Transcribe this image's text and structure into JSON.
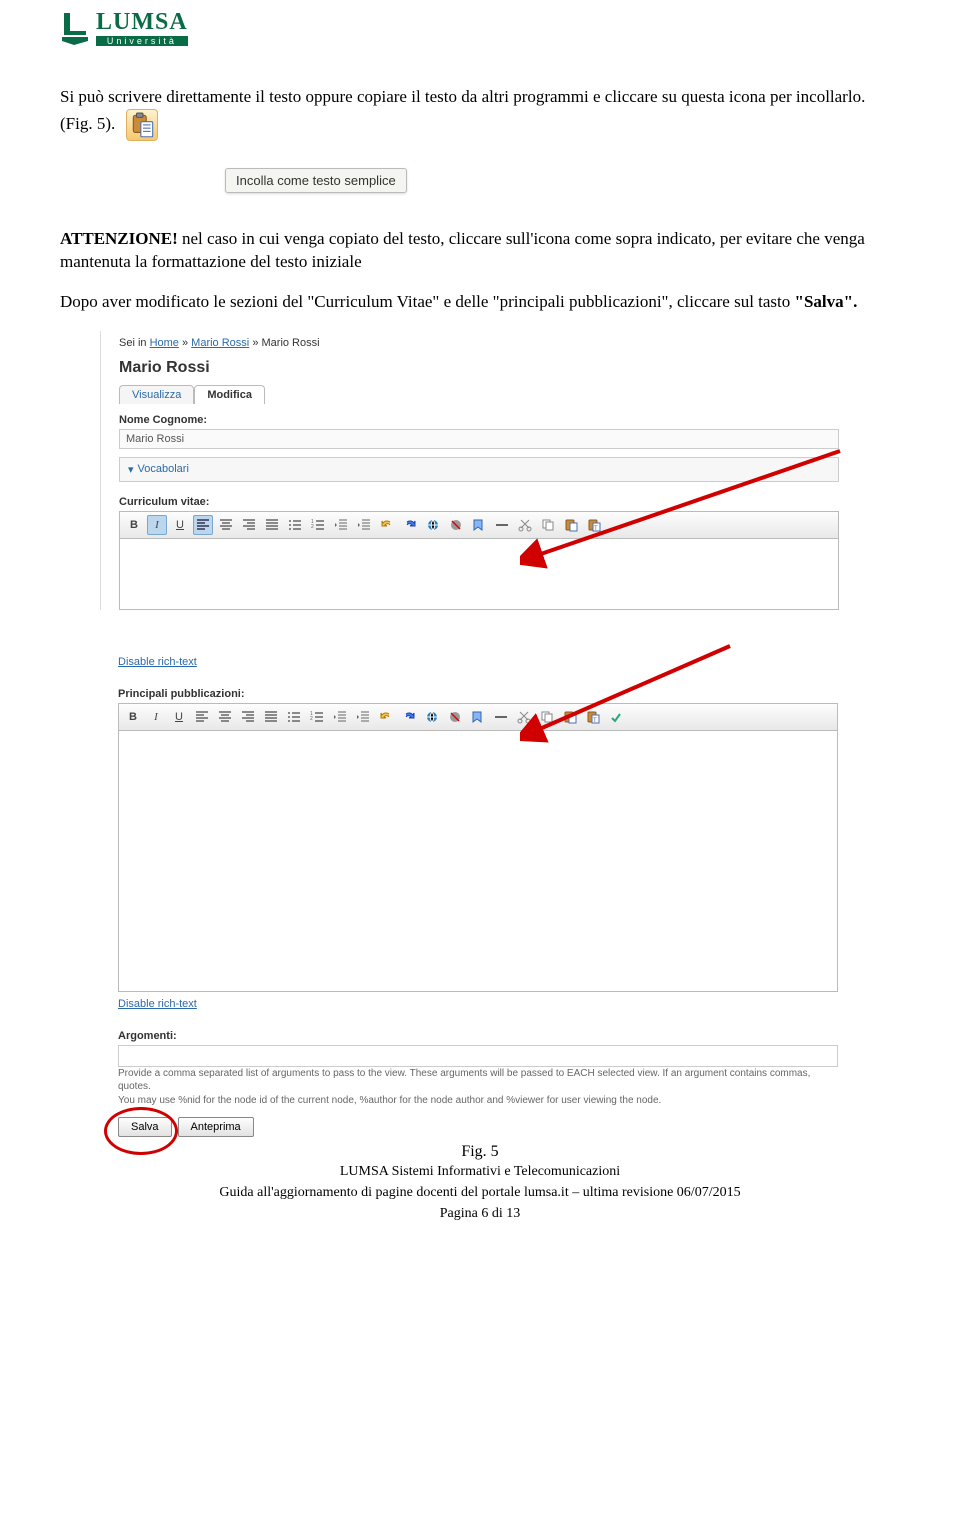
{
  "logo": {
    "name": "LUMSA",
    "sub": "Università"
  },
  "p1a": "Si può scrivere direttamente il testo oppure copiare il testo da altri programmi e cliccare su questa icona per incollarlo. (Fig. 5).",
  "tooltip": "Incolla come testo semplice",
  "p2": {
    "lead": "ATTENZIONE!",
    "rest": " nel caso in cui venga copiato del testo, cliccare sull'icona come sopra indicato, per evitare che venga mantenuta la formattazione del testo iniziale"
  },
  "p3a": "Dopo aver modificato le sezioni del \"Curriculum Vitae\" e delle \"principali pubblicazioni\", cliccare sul tasto ",
  "p3b": "\"Salva\".",
  "cms": {
    "bc": {
      "pre": "Sei in ",
      "home": "Home",
      "sep": " » ",
      "u1": "Mario Rossi",
      "u2": "Mario Rossi"
    },
    "title": "Mario Rossi",
    "tab_view": "Visualizza",
    "tab_edit": "Modifica",
    "lbl_name": "Nome Cognome:",
    "val_name": "Mario Rossi",
    "vocab": "Vocabolari",
    "lbl_cv": "Curriculum vitae:",
    "disable": "Disable rich-text",
    "lbl_pub": "Principali pubblicazioni:",
    "lbl_arg": "Argomenti:",
    "hint1": "Provide a comma separated list of arguments to pass to the view. These arguments will be passed to EACH selected view. If an argument contains commas, quotes.",
    "hint2": "You may use %nid for the node id of the current node, %author for the node author and %viewer for user viewing the node.",
    "btn_save": "Salva",
    "btn_prev": "Anteprima"
  },
  "fig": "Fig. 5",
  "foot1": "LUMSA Sistemi Informativi e Telecomunicazioni",
  "foot2": "Guida all'aggiornamento di pagine docenti del portale lumsa.it – ultima revisione 06/07/2015",
  "foot3": "Pagina 6 di 13"
}
